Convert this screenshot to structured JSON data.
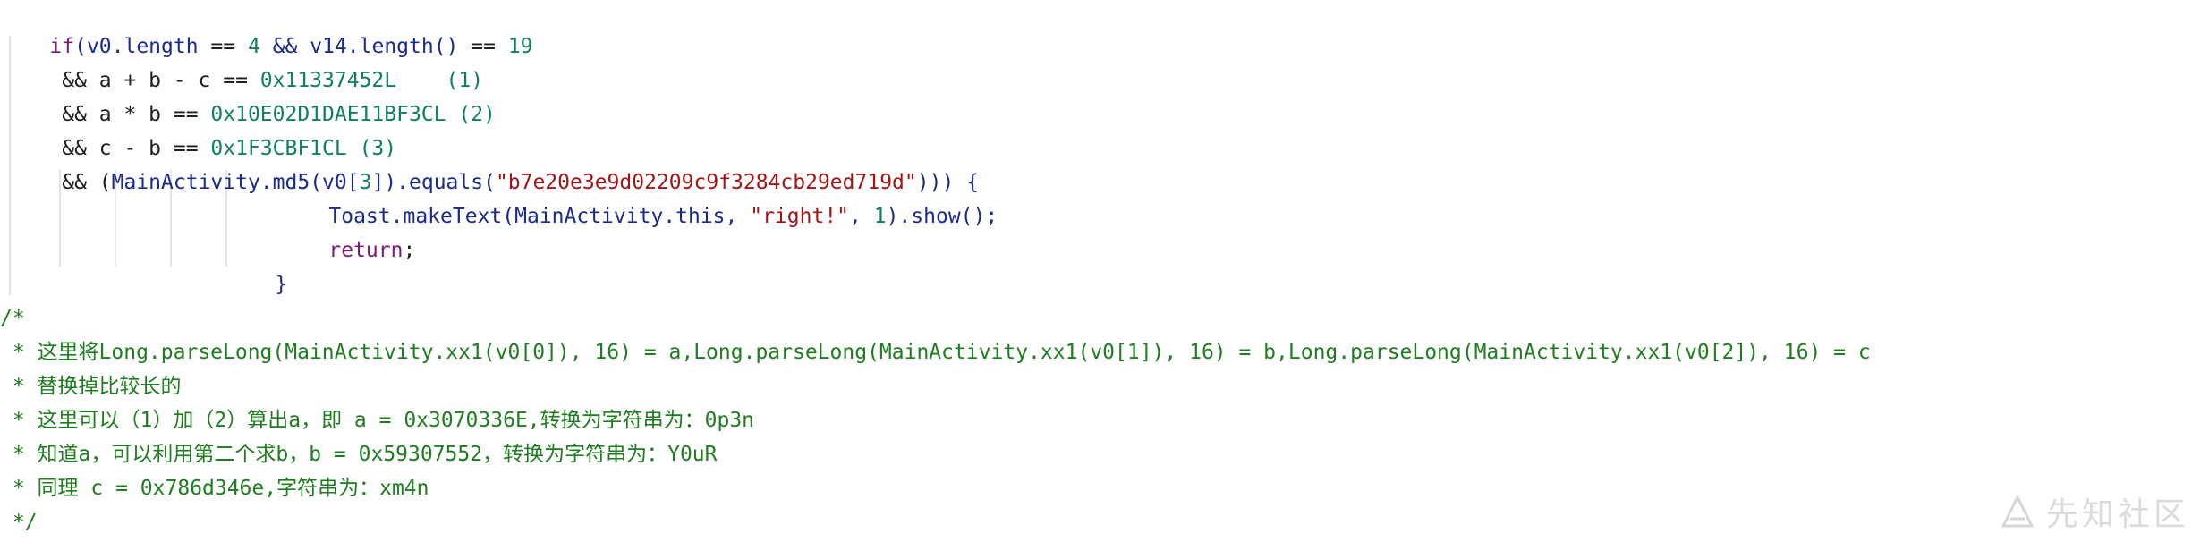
{
  "code": {
    "l1": {
      "a": "if",
      "b": "(v0.length ",
      "c": "==",
      "d": " ",
      "e": "4",
      "f": " && v14.length() ",
      "g": "==",
      "h": " ",
      "i": "19"
    },
    "l2": {
      "a": " && a + b - c == ",
      "b": "0x11337452L",
      "c": "    (1)"
    },
    "l3": {
      "a": " && a * b == ",
      "b": "0x10E02D1DAE11BF3CL",
      "c": " (2)"
    },
    "l4": {
      "a": " && c - b == ",
      "b": "0x1F3CBF1CL",
      "c": " (3)"
    },
    "l5": {
      "a": " && (",
      "b": "MainActivity",
      "c": ".md5(v0[",
      "d": "3",
      "e": "]).equals(",
      "f": "\"b7e20e3e9d02209c9f3284cb29ed719d\"",
      "g": "))) {"
    },
    "l6": {
      "a": "Toast",
      "b": ".makeText(",
      "c": "MainActivity",
      "d": ".this, ",
      "e": "\"right!\"",
      "f": ", ",
      "g": "1",
      "h": ").show();"
    },
    "l7": {
      "a": "return",
      "b": ";"
    },
    "l8": {
      "a": "}"
    }
  },
  "comment": {
    "open": "/*",
    "c1": " * 这里将Long.parseLong(MainActivity.xx1(v0[0]), 16) = a,Long.parseLong(MainActivity.xx1(v0[1]), 16) = b,Long.parseLong(MainActivity.xx1(v0[2]), 16) = c",
    "c2": " * 替换掉比较长的",
    "c3": " * 这里可以（1）加（2）算出a，即 a = 0x3070336E,转换为字符串为：0p3n",
    "c4": " * 知道a，可以利用第二个求b，b = 0x59307552，转换为字符串为：Y0uR",
    "c5": " * 同理 c = 0x786d346e,字符串为：xm4n",
    "close": " */"
  },
  "watermark": {
    "text": "先知社区",
    "icon": "xianzhi-logo-icon"
  },
  "colors": {
    "keyword": "#7a1a7a",
    "number": "#0f7f5f",
    "string": "#a31515",
    "identifier": "#1b2b8c",
    "comment": "#1e7d1e",
    "guide": "#e4e4e4"
  }
}
